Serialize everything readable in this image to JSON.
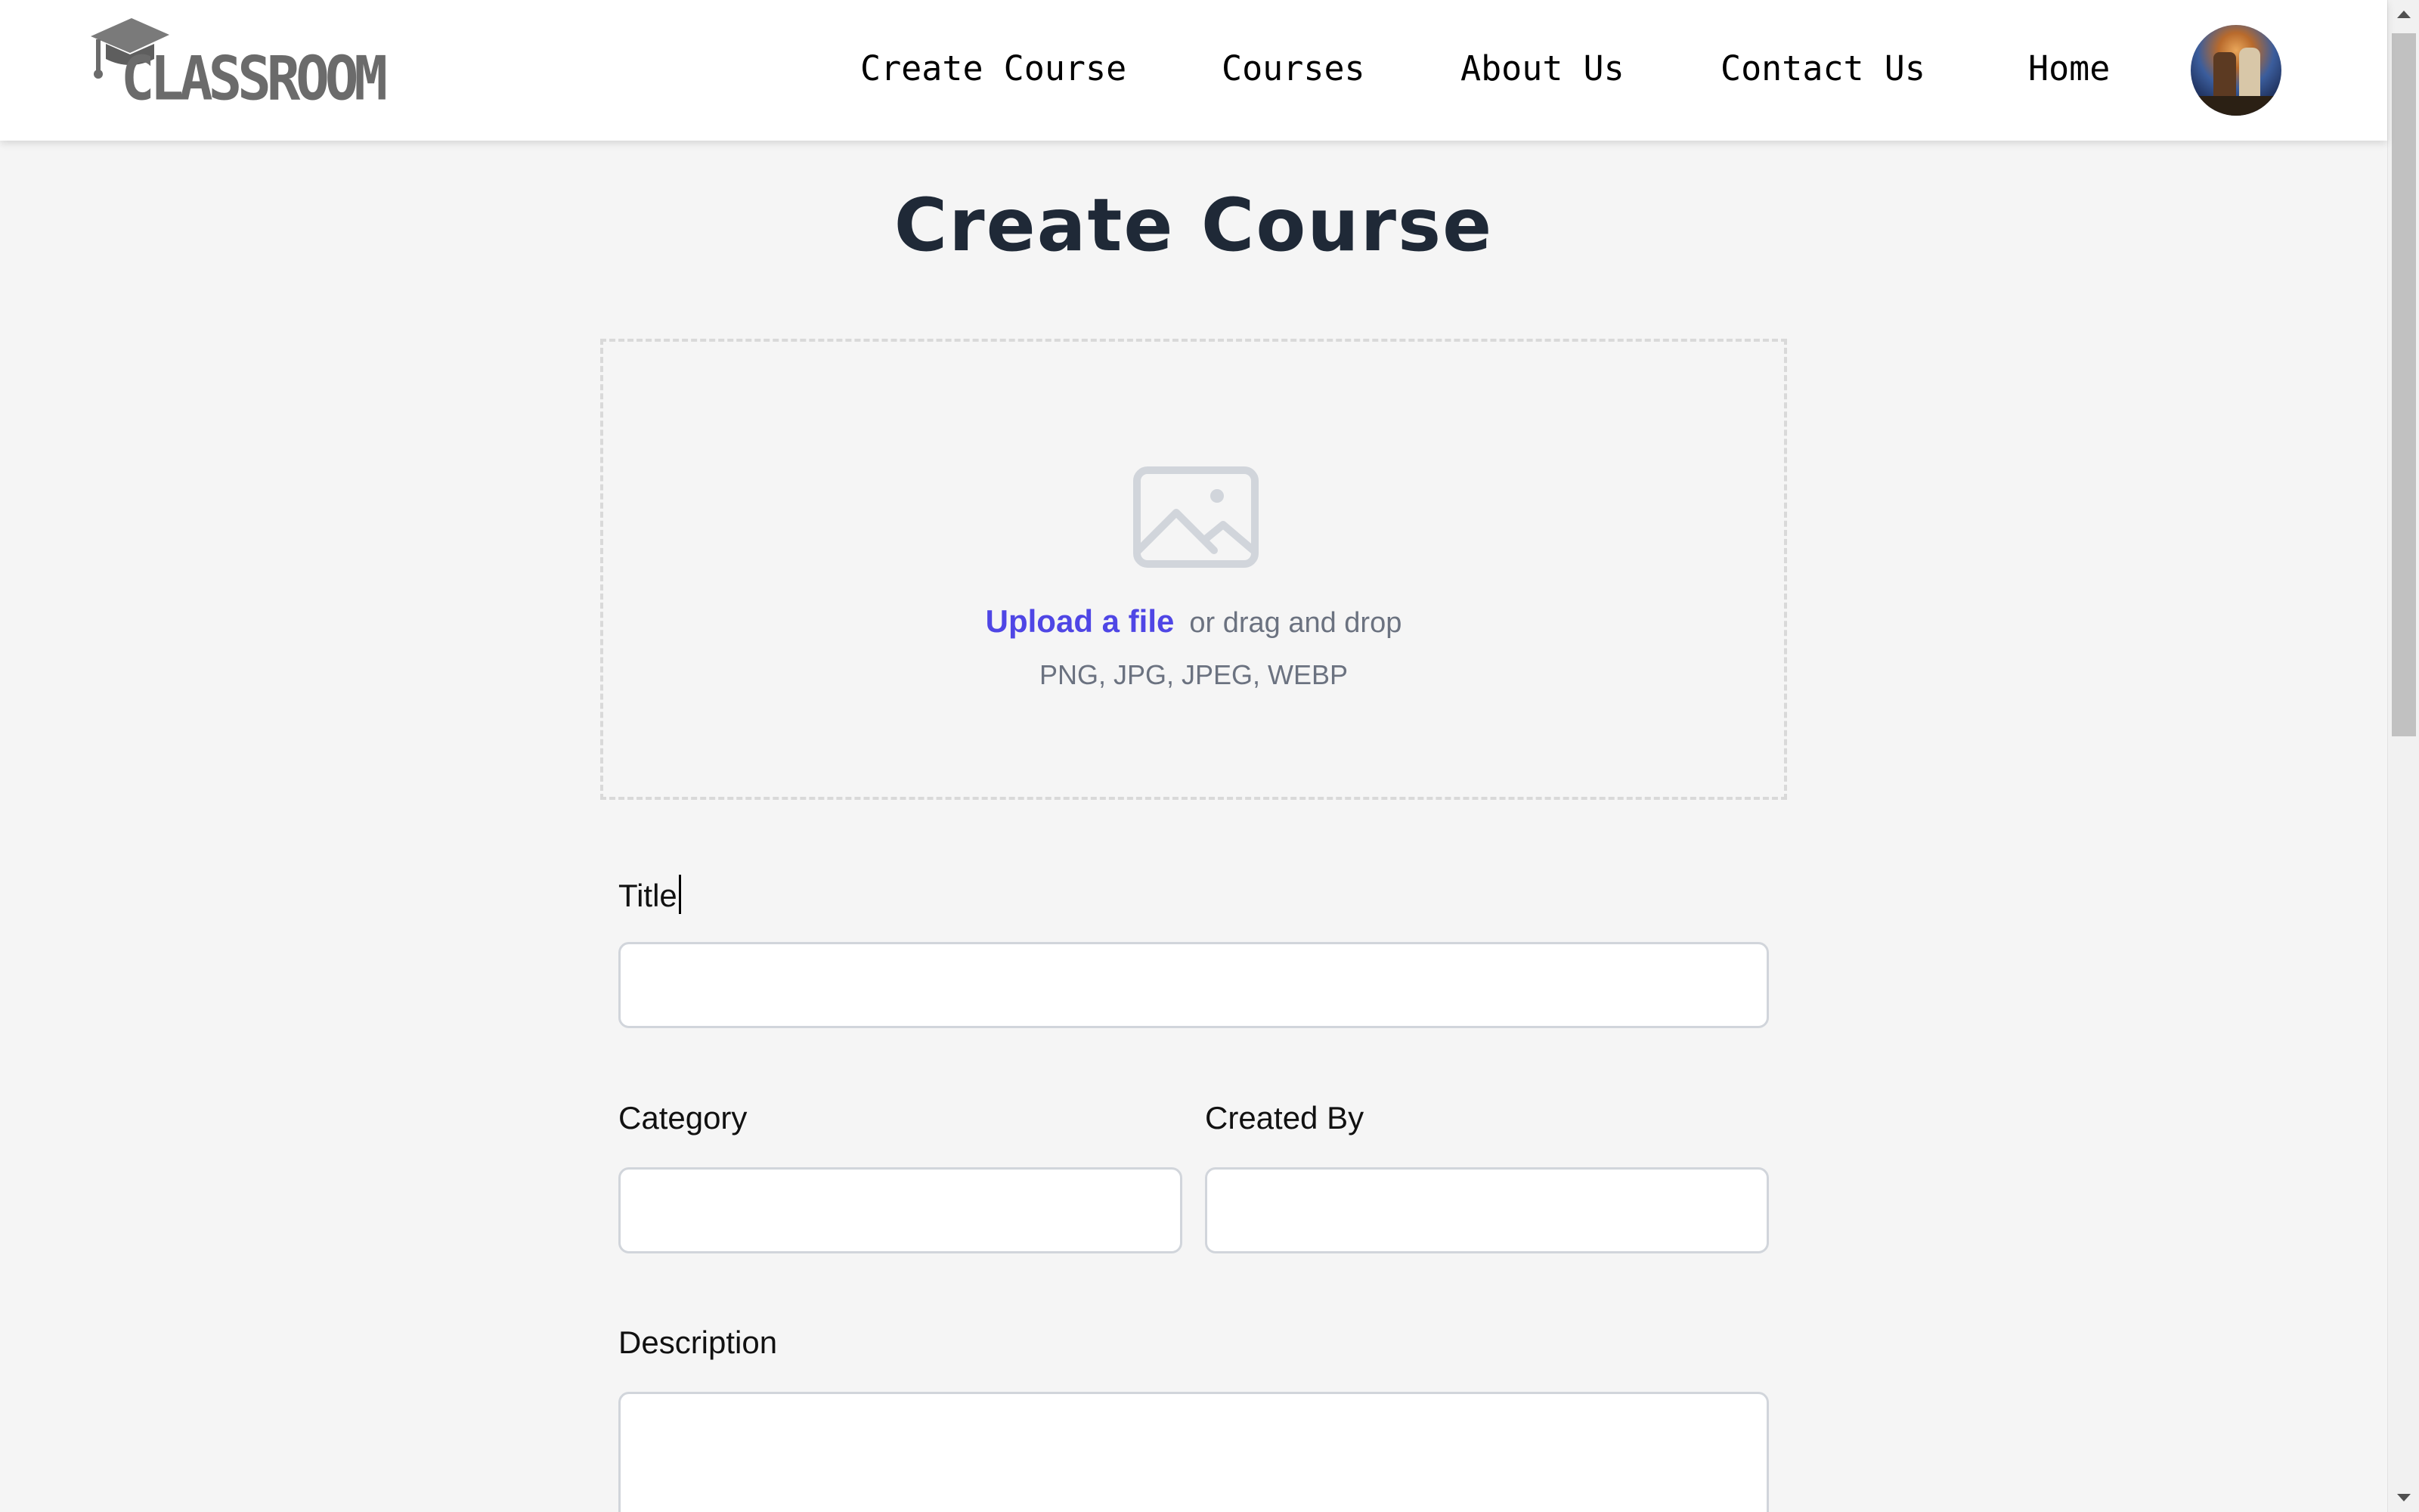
{
  "header": {
    "logo_text": "CLASSROOM",
    "nav": [
      {
        "label": "Create Course"
      },
      {
        "label": "Courses"
      },
      {
        "label": "About Us"
      },
      {
        "label": "Contact Us"
      },
      {
        "label": "Home"
      }
    ],
    "avatar_icon": "user-avatar"
  },
  "main": {
    "title": "Create Course",
    "upload": {
      "icon": "photo-icon",
      "link_label": "Upload a file",
      "hint": "or drag and drop",
      "file_types": "PNG, JPG, JPEG, WEBP"
    },
    "form": {
      "title_label": "Title",
      "title_value": "",
      "category_label": "Category",
      "category_value": "",
      "created_by_label": "Created By",
      "created_by_value": "",
      "description_label": "Description",
      "description_value": ""
    }
  },
  "colors": {
    "accent": "#4f46e5",
    "heading": "#1f2937",
    "muted_text": "#6b7280",
    "border": "#d1d5db",
    "background": "#f5f5f5"
  }
}
